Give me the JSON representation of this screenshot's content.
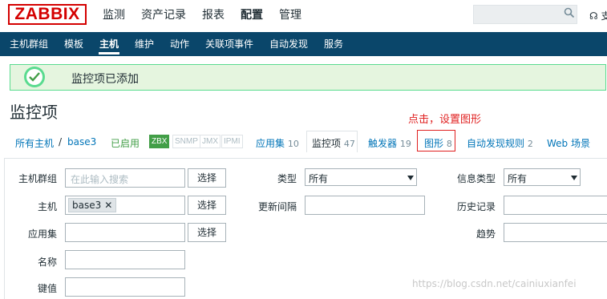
{
  "header": {
    "logo": "ZABBIX",
    "nav": [
      "监测",
      "资产记录",
      "报表",
      "配置",
      "管理"
    ],
    "active_nav": "配置",
    "support": "支"
  },
  "subnav": {
    "items": [
      "主机群组",
      "模板",
      "主机",
      "维护",
      "动作",
      "关联项事件",
      "自动发现",
      "服务"
    ],
    "active": "主机"
  },
  "message": {
    "text": "监控项已添加",
    "status_color": "#59db8f"
  },
  "page_title": "监控项",
  "annotation": "点击，设置图形",
  "host_tabs": {
    "all_hosts": "所有主机",
    "separator": "/",
    "host": "base3",
    "enabled": "已启用",
    "badges": [
      "ZBX",
      "SNMP",
      "JMX",
      "IPMI"
    ],
    "tabs": [
      {
        "label": "应用集",
        "count": "10"
      },
      {
        "label": "监控项",
        "count": "47"
      },
      {
        "label": "触发器",
        "count": "19"
      },
      {
        "label": "图形",
        "count": "8"
      },
      {
        "label": "自动发现规则",
        "count": "2"
      },
      {
        "label": "Web 场景",
        "count": ""
      }
    ]
  },
  "filter": {
    "host_group_label": "主机群组",
    "host_group_placeholder": "在此输入搜索",
    "select_label": "选择",
    "host_label": "主机",
    "host_chip": "base3",
    "app_label": "应用集",
    "name_label": "名称",
    "key_label": "键值",
    "type_label": "类型",
    "type_value": "所有",
    "interval_label": "更新间隔",
    "info_type_label": "信息类型",
    "info_type_value": "所有",
    "history_label": "历史记录",
    "trend_label": "趋势"
  },
  "watermark": "https://blog.csdn.net/cainiuxianfei"
}
